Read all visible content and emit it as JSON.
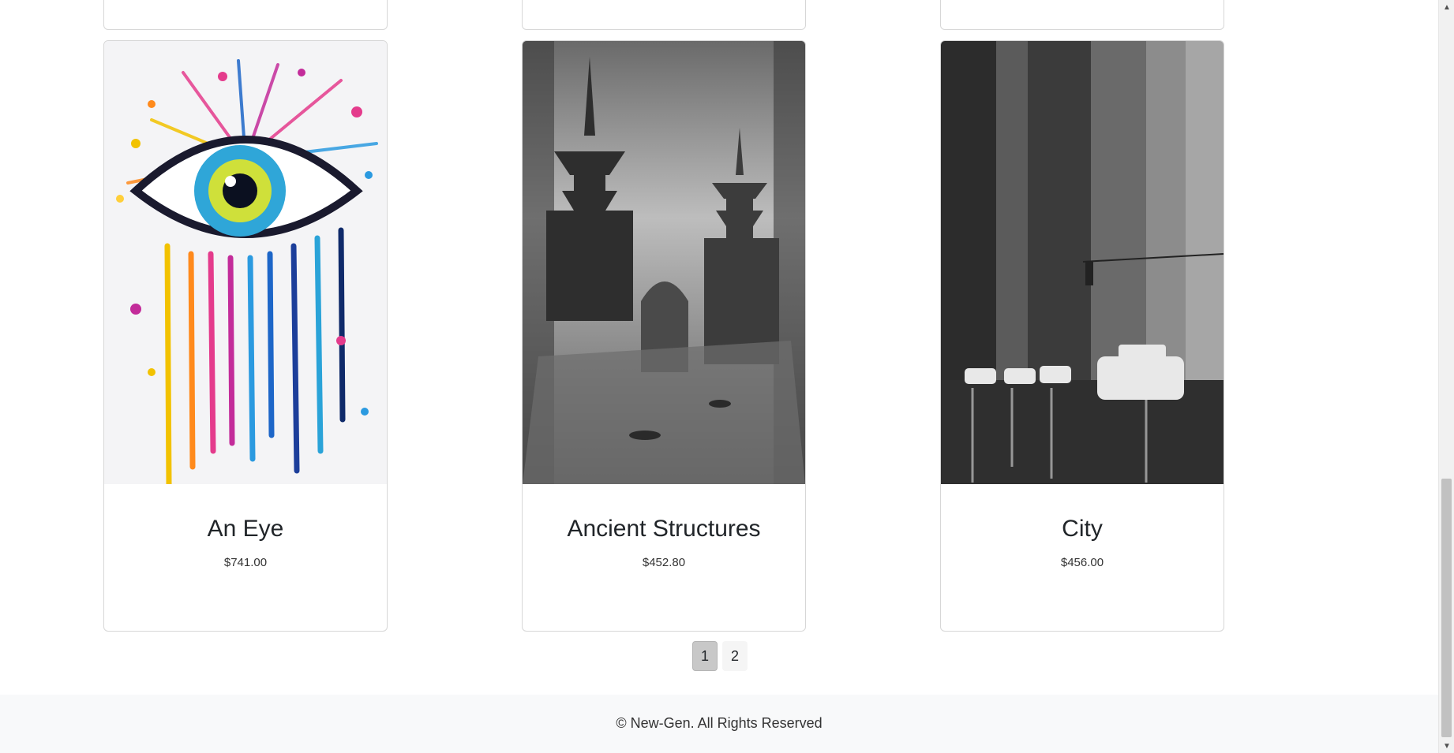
{
  "products": [
    {
      "title": "An Eye",
      "price": "$741.00",
      "image": "colorful-eye-painting"
    },
    {
      "title": "Ancient Structures",
      "price": "$452.80",
      "image": "ancient-pagoda-sketch"
    },
    {
      "title": "City",
      "price": "$456.00",
      "image": "rainy-city-sketch"
    }
  ],
  "pagination": {
    "pages": [
      "1",
      "2"
    ],
    "current": "1"
  },
  "footer": {
    "text": "© New-Gen. All Rights Reserved"
  },
  "icons": {
    "scroll_up": "up-arrow-icon",
    "scroll_down": "down-arrow-icon"
  }
}
